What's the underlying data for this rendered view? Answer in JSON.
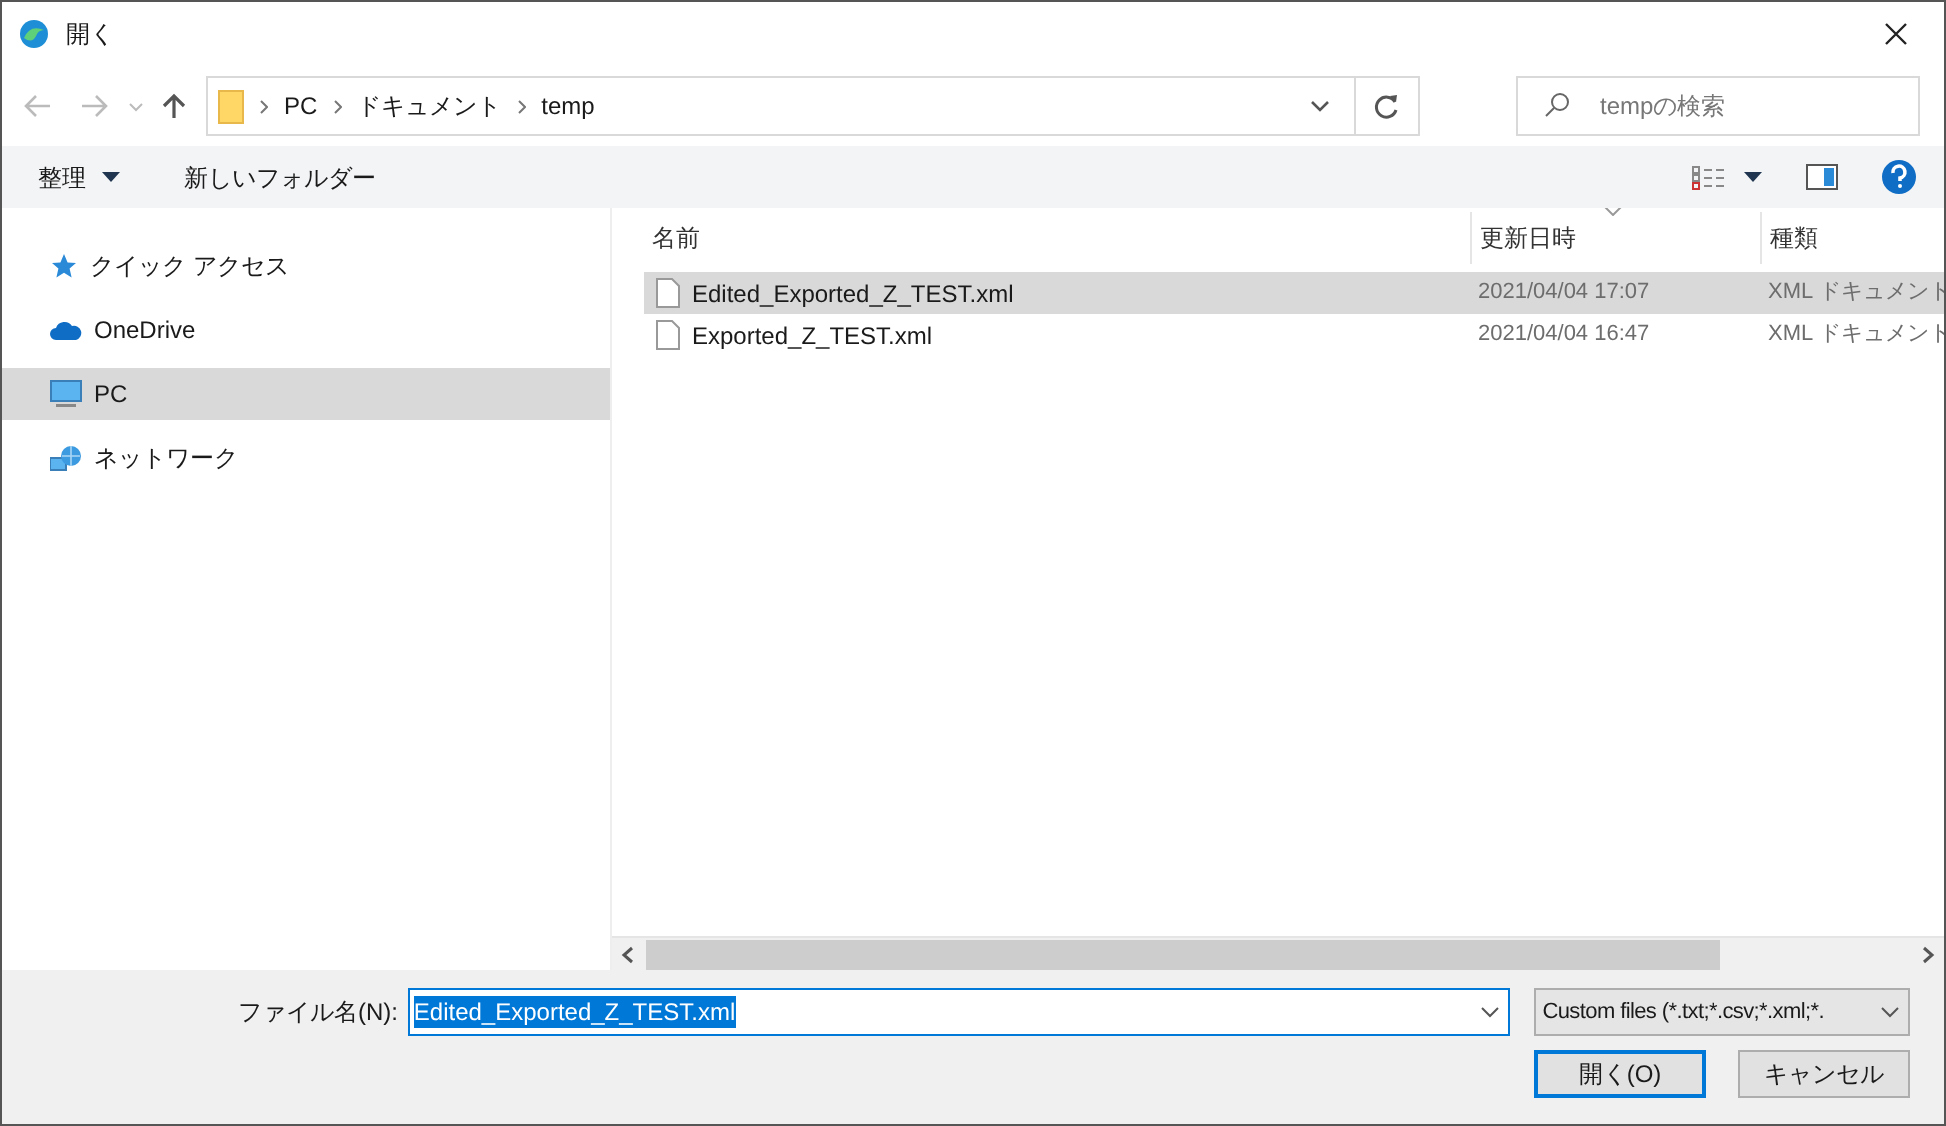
{
  "window": {
    "title": "開く"
  },
  "address": {
    "crumbs": [
      "PC",
      "ドキュメント",
      "temp"
    ]
  },
  "search": {
    "placeholder": "tempの検索"
  },
  "toolbar": {
    "organize": "整理",
    "new_folder": "新しいフォルダー"
  },
  "sidebar": {
    "items": [
      {
        "label": "クイック アクセス",
        "kind": "star",
        "selected": false
      },
      {
        "label": "OneDrive",
        "kind": "cloud",
        "selected": false
      },
      {
        "label": "PC",
        "kind": "pc",
        "selected": true
      },
      {
        "label": "ネットワーク",
        "kind": "network",
        "selected": false
      }
    ]
  },
  "table": {
    "columns": [
      "名前",
      "更新日時",
      "種類"
    ],
    "rows": [
      {
        "name": "Edited_Exported_Z_TEST.xml",
        "modified": "2021/04/04 17:07",
        "type": "XML ドキュメント",
        "selected": true
      },
      {
        "name": "Exported_Z_TEST.xml",
        "modified": "2021/04/04 16:47",
        "type": "XML ドキュメント",
        "selected": false
      }
    ]
  },
  "filename": {
    "label": "ファイル名(N):",
    "value": "Edited_Exported_Z_TEST.xml"
  },
  "filter": {
    "value": "Custom files (*.txt;*.csv;*.xml;*."
  },
  "buttons": [
    {
      "label": "開く(O)",
      "kind": "default"
    },
    {
      "label": "キャンセル",
      "kind": "normal"
    }
  ]
}
